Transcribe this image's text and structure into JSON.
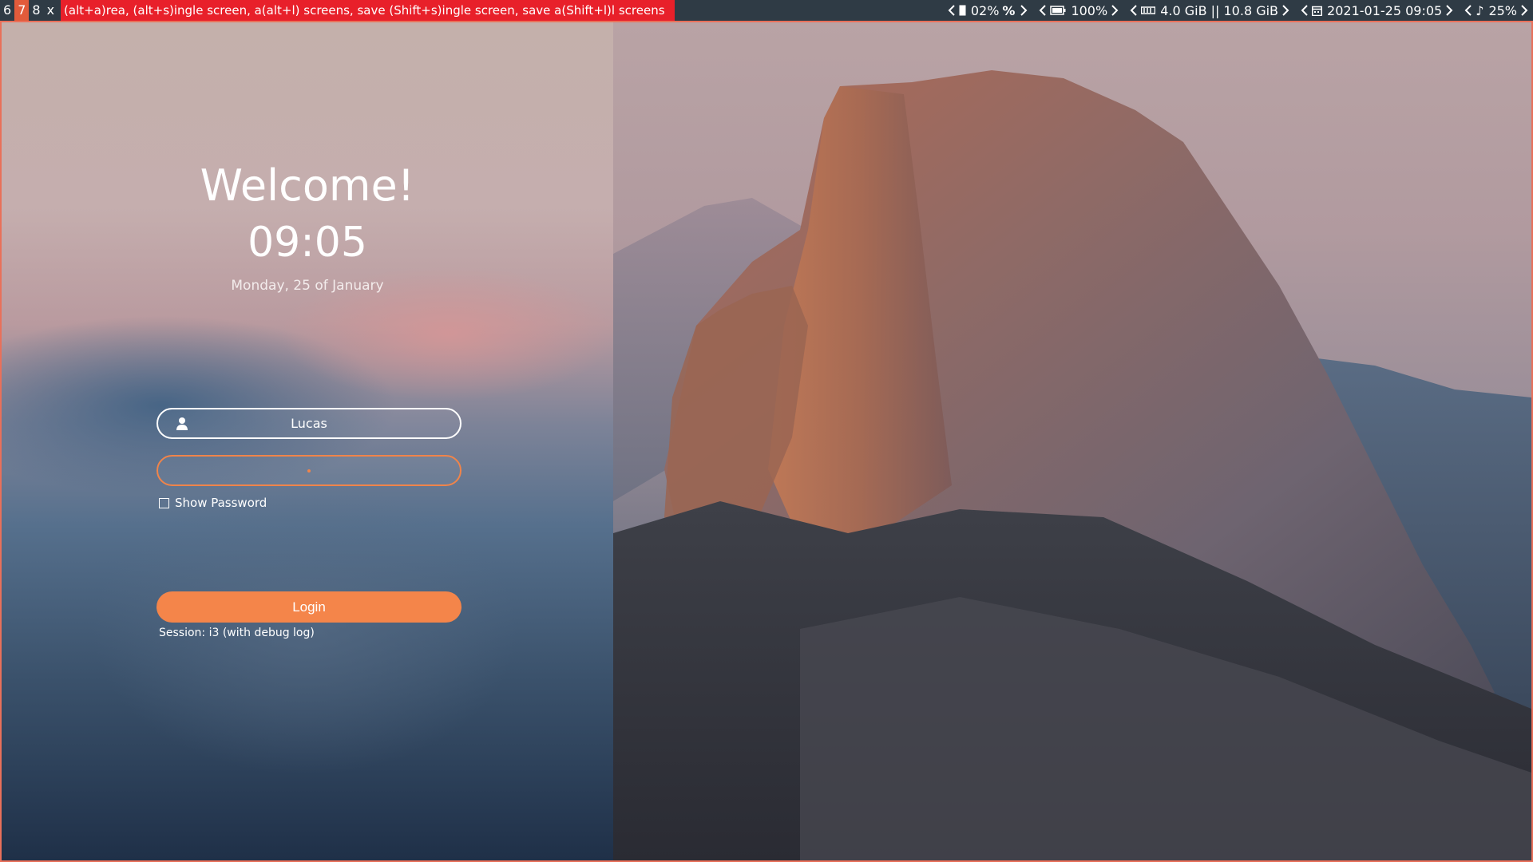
{
  "bar": {
    "workspaces": [
      "6",
      "7",
      "8",
      "x"
    ],
    "active_workspace": "7",
    "mode_text": "(alt+a)rea, (alt+s)ingle screen, a(alt+l) screens, save (Shift+s)ingle screen, save a(Shift+l)l screens",
    "status": {
      "cpu": "02%",
      "cpu_icon": "percent-icon",
      "battery": "100%",
      "memory": "4.0 GiB || 10.8 GiB",
      "datetime": "2021-01-25 09:05",
      "volume": "25%"
    },
    "colors": {
      "bar_bg": "#2f3b45",
      "active_ws": "#e25b3b",
      "mode_bg": "#e8202a"
    }
  },
  "login": {
    "welcome": "Welcome!",
    "time": "09:05",
    "date": "Monday, 25 of January",
    "username": "Lucas",
    "show_password_label": "Show Password",
    "login_button": "Login",
    "session": "Session: i3 (with debug log)",
    "accent": "#f4854a"
  }
}
